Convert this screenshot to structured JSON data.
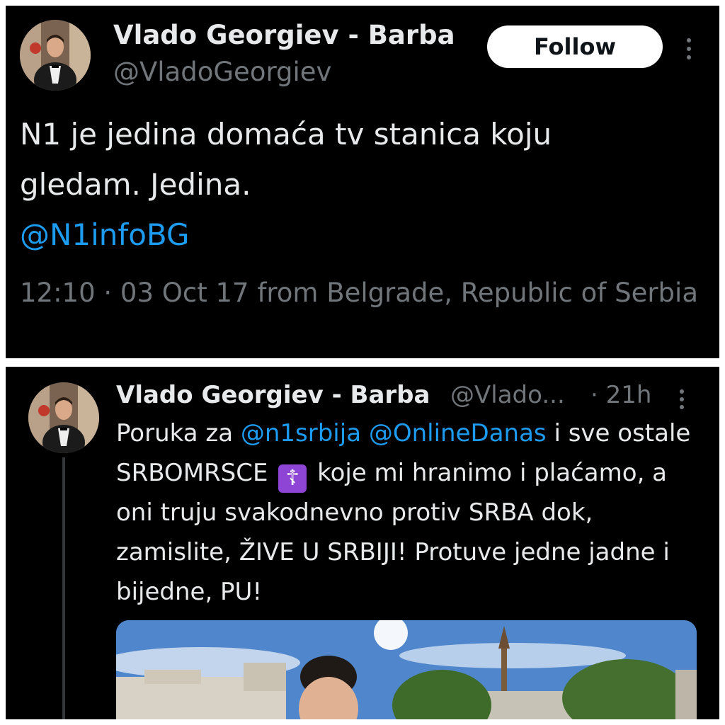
{
  "top_tweet": {
    "display_name": "Vlado Georgiev - Barba",
    "handle": "@VladoGeorgiev",
    "follow_label": "Follow",
    "text_line1": "N1 je jedina domaća tv stanica koju",
    "text_line2": "gledam. Jedina.",
    "mention": "@N1infoBG",
    "meta": "12:10 · 03 Oct 17 from Belgrade, Republic of Serbia"
  },
  "bottom_tweet": {
    "display_name": "Vlado Georgiev - Barba",
    "handle": "@Vlado...",
    "time": "· 21h",
    "text_a": "Poruka za ",
    "mention1": "@n1srbija",
    "text_b": " ",
    "mention2": "@OnlineDanas",
    "text_c": " i sve ostale SRBOMRSCE ",
    "emoji": "☦",
    "text_d": " koje mi hranimo i plaćamo, a oni truju svakodnevno protiv SRBA dok, zamislite, ŽIVE U SRBIJI! Protuve jedne jadne i bijedne, PU!"
  },
  "colors": {
    "background": "#000000",
    "text": "#e7e9ea",
    "muted": "#71767b",
    "link": "#1d9bf0",
    "emoji_bg": "#8e44d4"
  }
}
